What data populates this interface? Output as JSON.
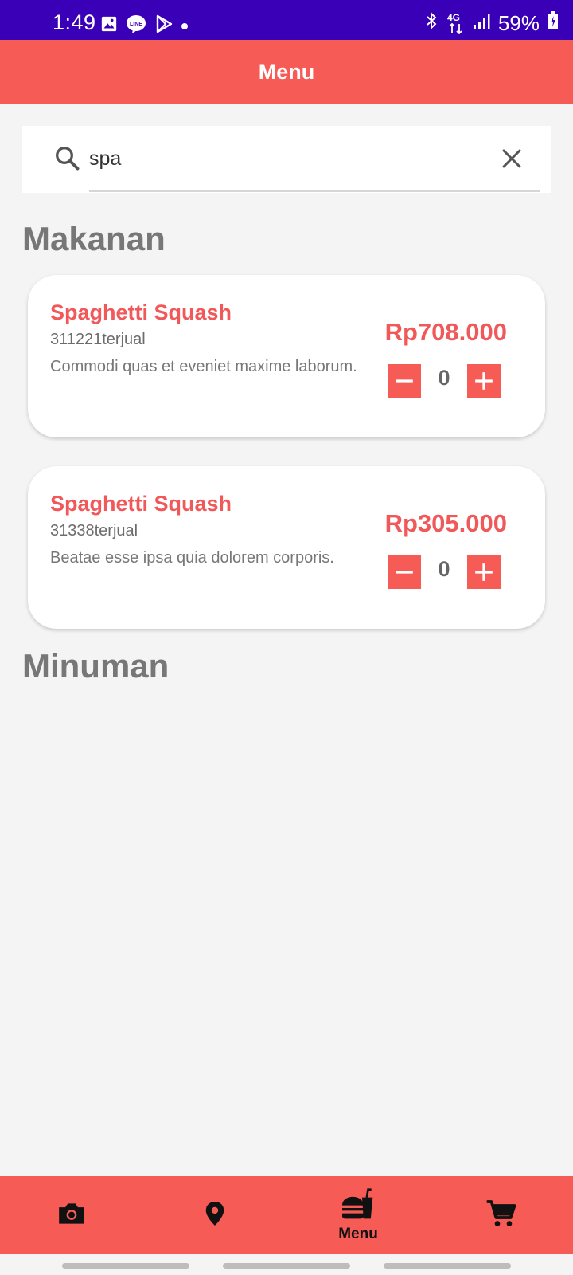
{
  "status_bar": {
    "time": "1:49",
    "network": "4G",
    "battery": "59%"
  },
  "app_bar": {
    "title": "Menu"
  },
  "search": {
    "value": "spa",
    "placeholder": ""
  },
  "sections": [
    {
      "title": "Makanan"
    },
    {
      "title": "Minuman"
    }
  ],
  "items": [
    {
      "name": "Spaghetti Squash",
      "sold": "311221terjual",
      "description": "Commodi quas et eveniet maxime laborum.",
      "price": "Rp708.000",
      "quantity": "0"
    },
    {
      "name": "Spaghetti Squash",
      "sold": "31338terjual",
      "description": "Beatae esse ipsa quia dolorem corporis.",
      "price": "Rp305.000",
      "quantity": "0"
    }
  ],
  "bottom_nav": [
    {
      "icon": "camera-icon",
      "label": ""
    },
    {
      "icon": "location-pin-icon",
      "label": ""
    },
    {
      "icon": "fastfood-icon",
      "label": "Menu",
      "active": true
    },
    {
      "icon": "cart-icon",
      "label": ""
    }
  ],
  "colors": {
    "accent": "#f75b55",
    "status_bar": "#3a00b8",
    "price": "#f0585a",
    "background": "#f4f4f4"
  }
}
